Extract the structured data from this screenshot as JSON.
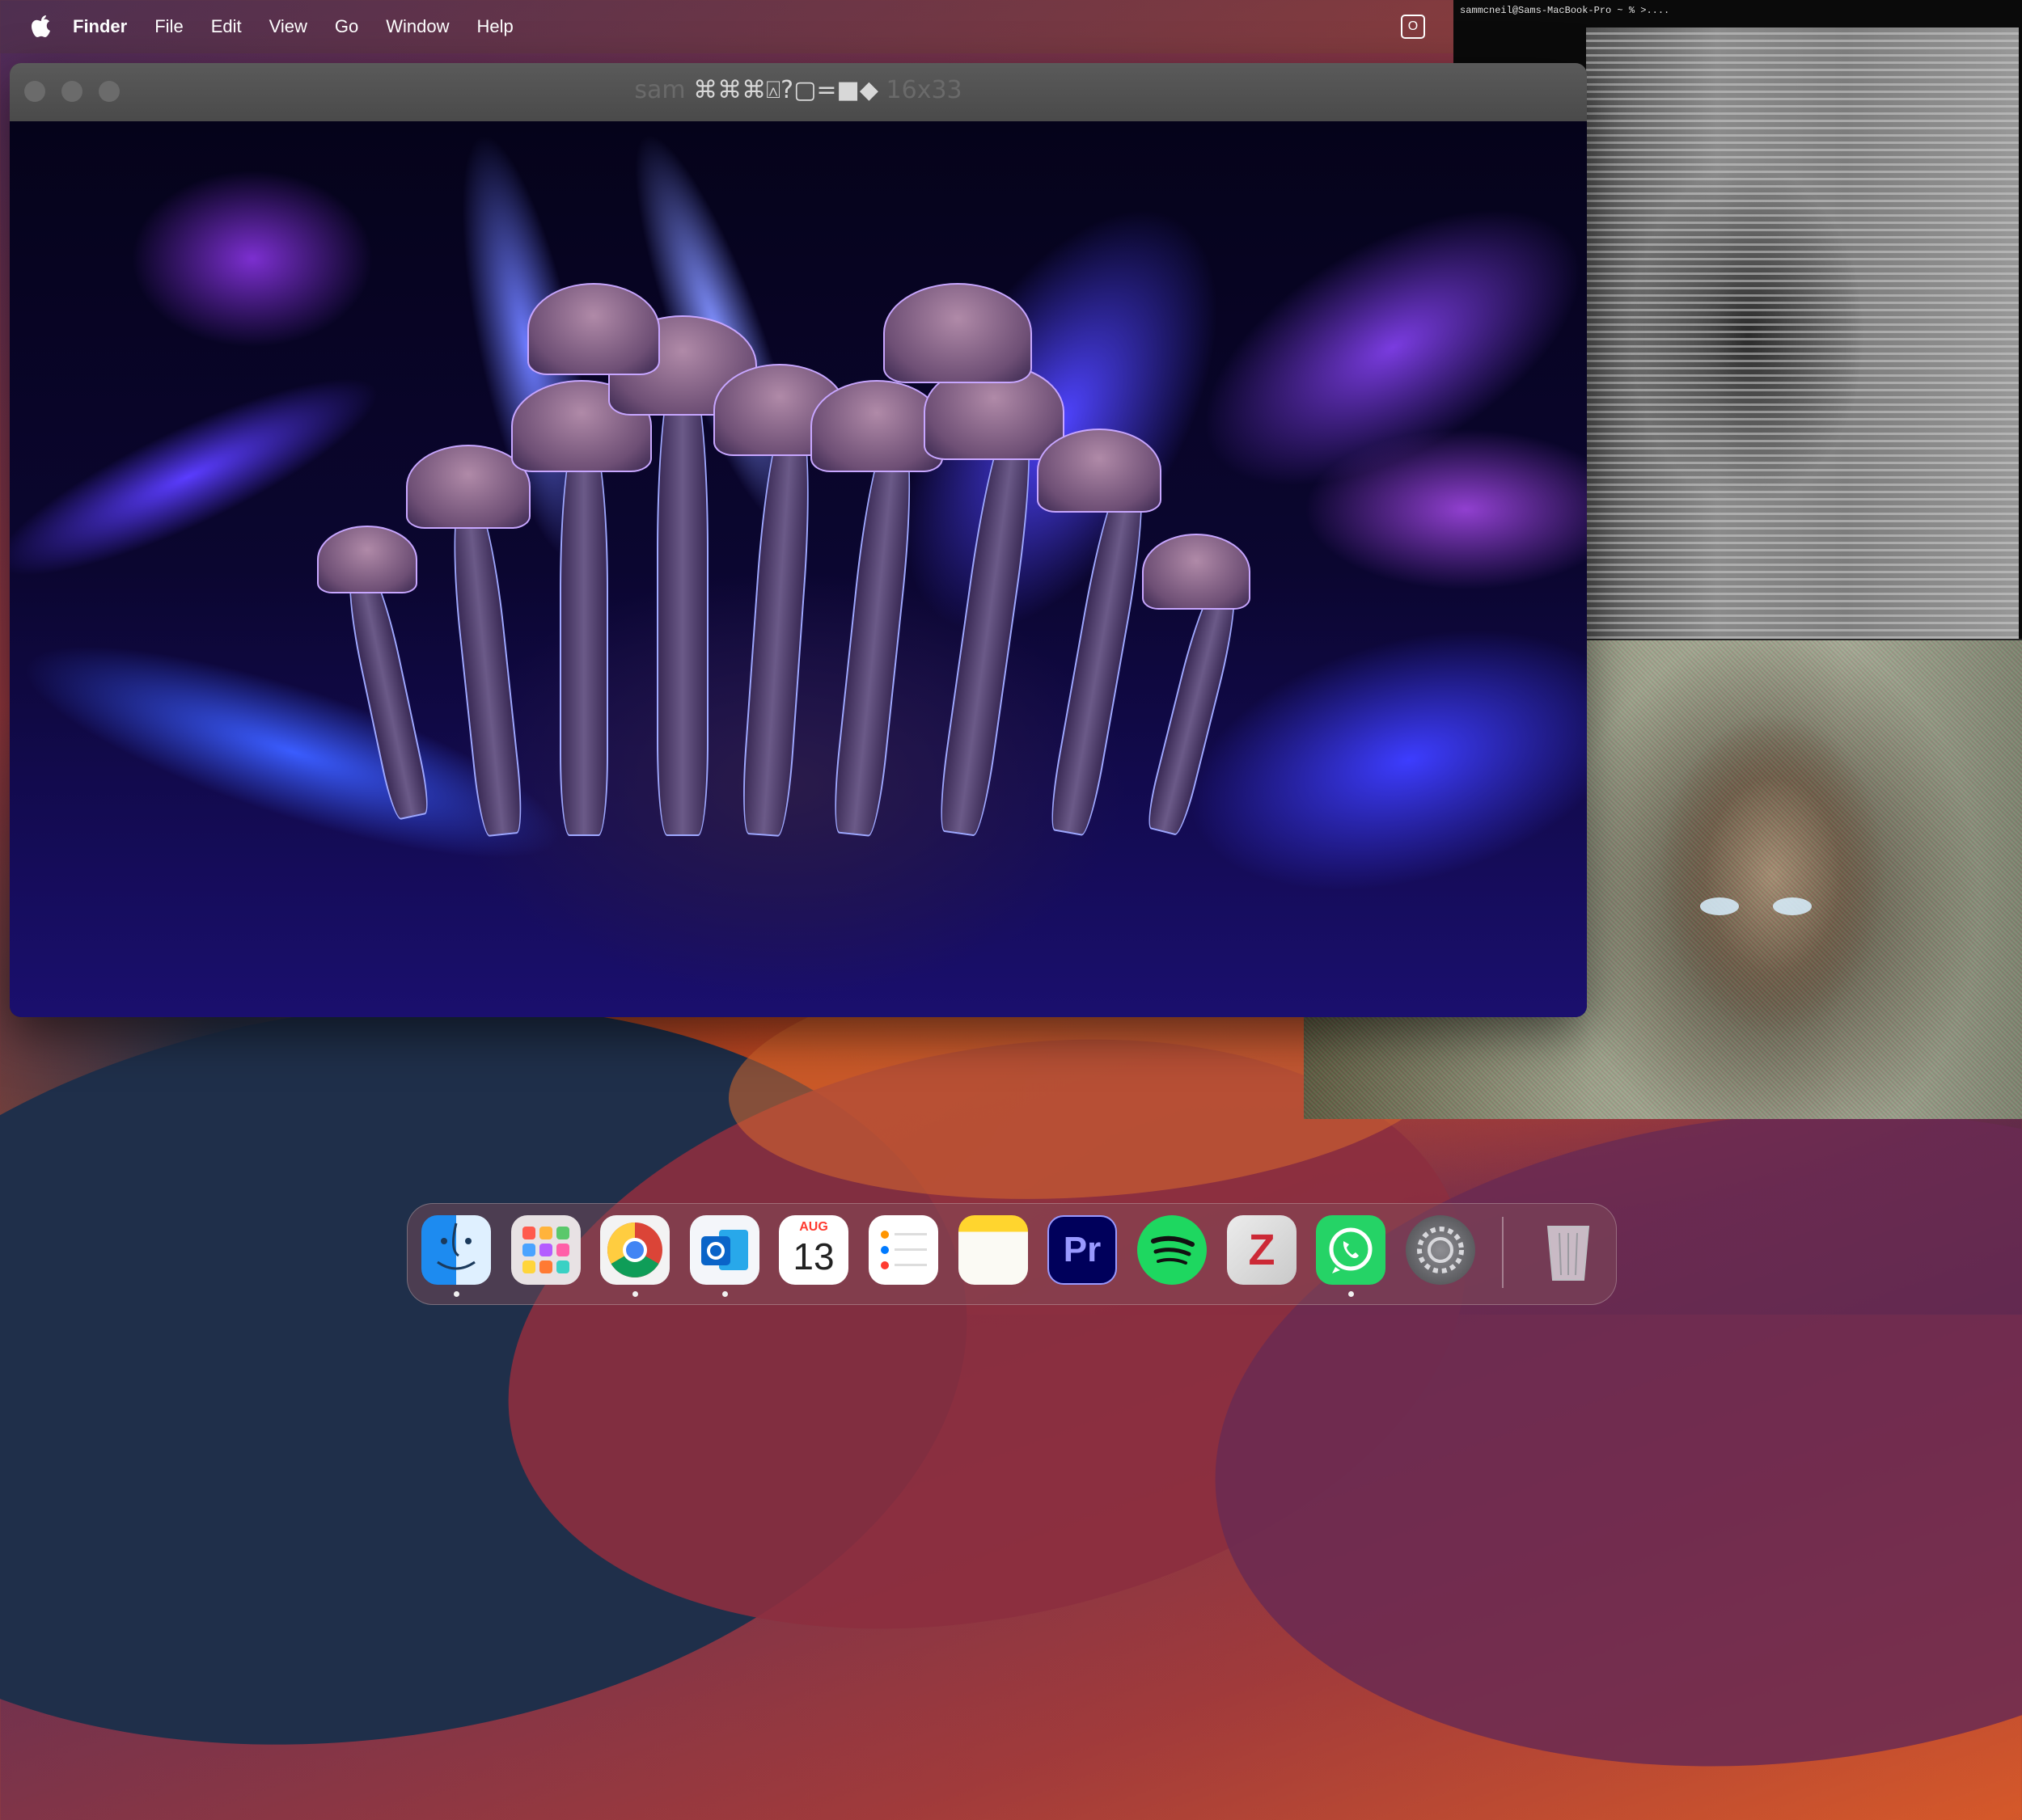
{
  "menubar": {
    "apple_icon": "apple-icon",
    "app_name": "Finder",
    "items": [
      "File",
      "Edit",
      "View",
      "Go",
      "Window",
      "Help"
    ],
    "status_icon": "outlook-status-icon"
  },
  "terminal": {
    "prompt": "sammcneil@Sams-MacBook-Pro ~ % >...."
  },
  "window": {
    "title_prefix": "sam",
    "title_glyphs": "⌘⌘⌘⍓?▢=■◆",
    "title_suffix": "16x33"
  },
  "dock": {
    "apps": [
      {
        "name": "Finder",
        "icon": "finder-icon",
        "running": true
      },
      {
        "name": "Launchpad",
        "icon": "launchpad-icon",
        "running": false
      },
      {
        "name": "Google Chrome",
        "icon": "chrome-icon",
        "running": true
      },
      {
        "name": "Microsoft Outlook",
        "icon": "outlook-icon",
        "running": true
      },
      {
        "name": "Calendar",
        "icon": "calendar-icon",
        "running": false,
        "month": "AUG",
        "day": "13"
      },
      {
        "name": "Reminders",
        "icon": "reminders-icon",
        "running": false
      },
      {
        "name": "Notes",
        "icon": "notes-icon",
        "running": false
      },
      {
        "name": "Adobe Premiere Pro",
        "icon": "premiere-icon",
        "running": false,
        "label": "Pr"
      },
      {
        "name": "Spotify",
        "icon": "spotify-icon",
        "running": false
      },
      {
        "name": "Zotero",
        "icon": "zotero-icon",
        "running": false,
        "label": "Z"
      },
      {
        "name": "WhatsApp",
        "icon": "whatsapp-icon",
        "running": true
      },
      {
        "name": "System Settings",
        "icon": "settings-icon",
        "running": false
      },
      {
        "name": "Trash",
        "icon": "trash-icon",
        "running": false
      }
    ]
  },
  "colors": {
    "premiere_bg": "#00005b",
    "premiere_text": "#9999ff",
    "spotify": "#1ed760",
    "whatsapp": "#25d366",
    "zotero": "#cc2936"
  }
}
